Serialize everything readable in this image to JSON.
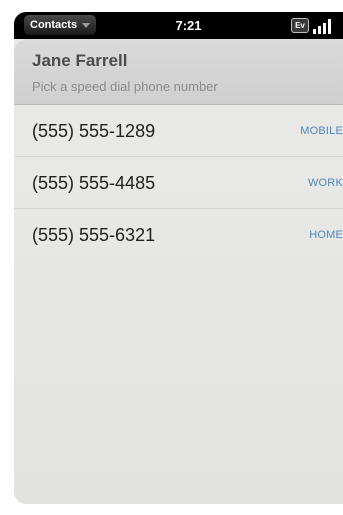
{
  "status_bar": {
    "app_menu": "Contacts",
    "time": "7:21",
    "network": "Ev"
  },
  "header": {
    "name": "Jane Farrell",
    "prompt": "Pick a speed dial phone number"
  },
  "numbers": [
    {
      "number": "(555) 555-1289",
      "type": "MOBILE"
    },
    {
      "number": "(555) 555-4485",
      "type": "WORK"
    },
    {
      "number": "(555) 555-6321",
      "type": "HOME"
    }
  ],
  "colors": {
    "type_label": "#4d87bd",
    "header_bg": "#d2d2d2",
    "card_bg": "#e7e7e5"
  }
}
